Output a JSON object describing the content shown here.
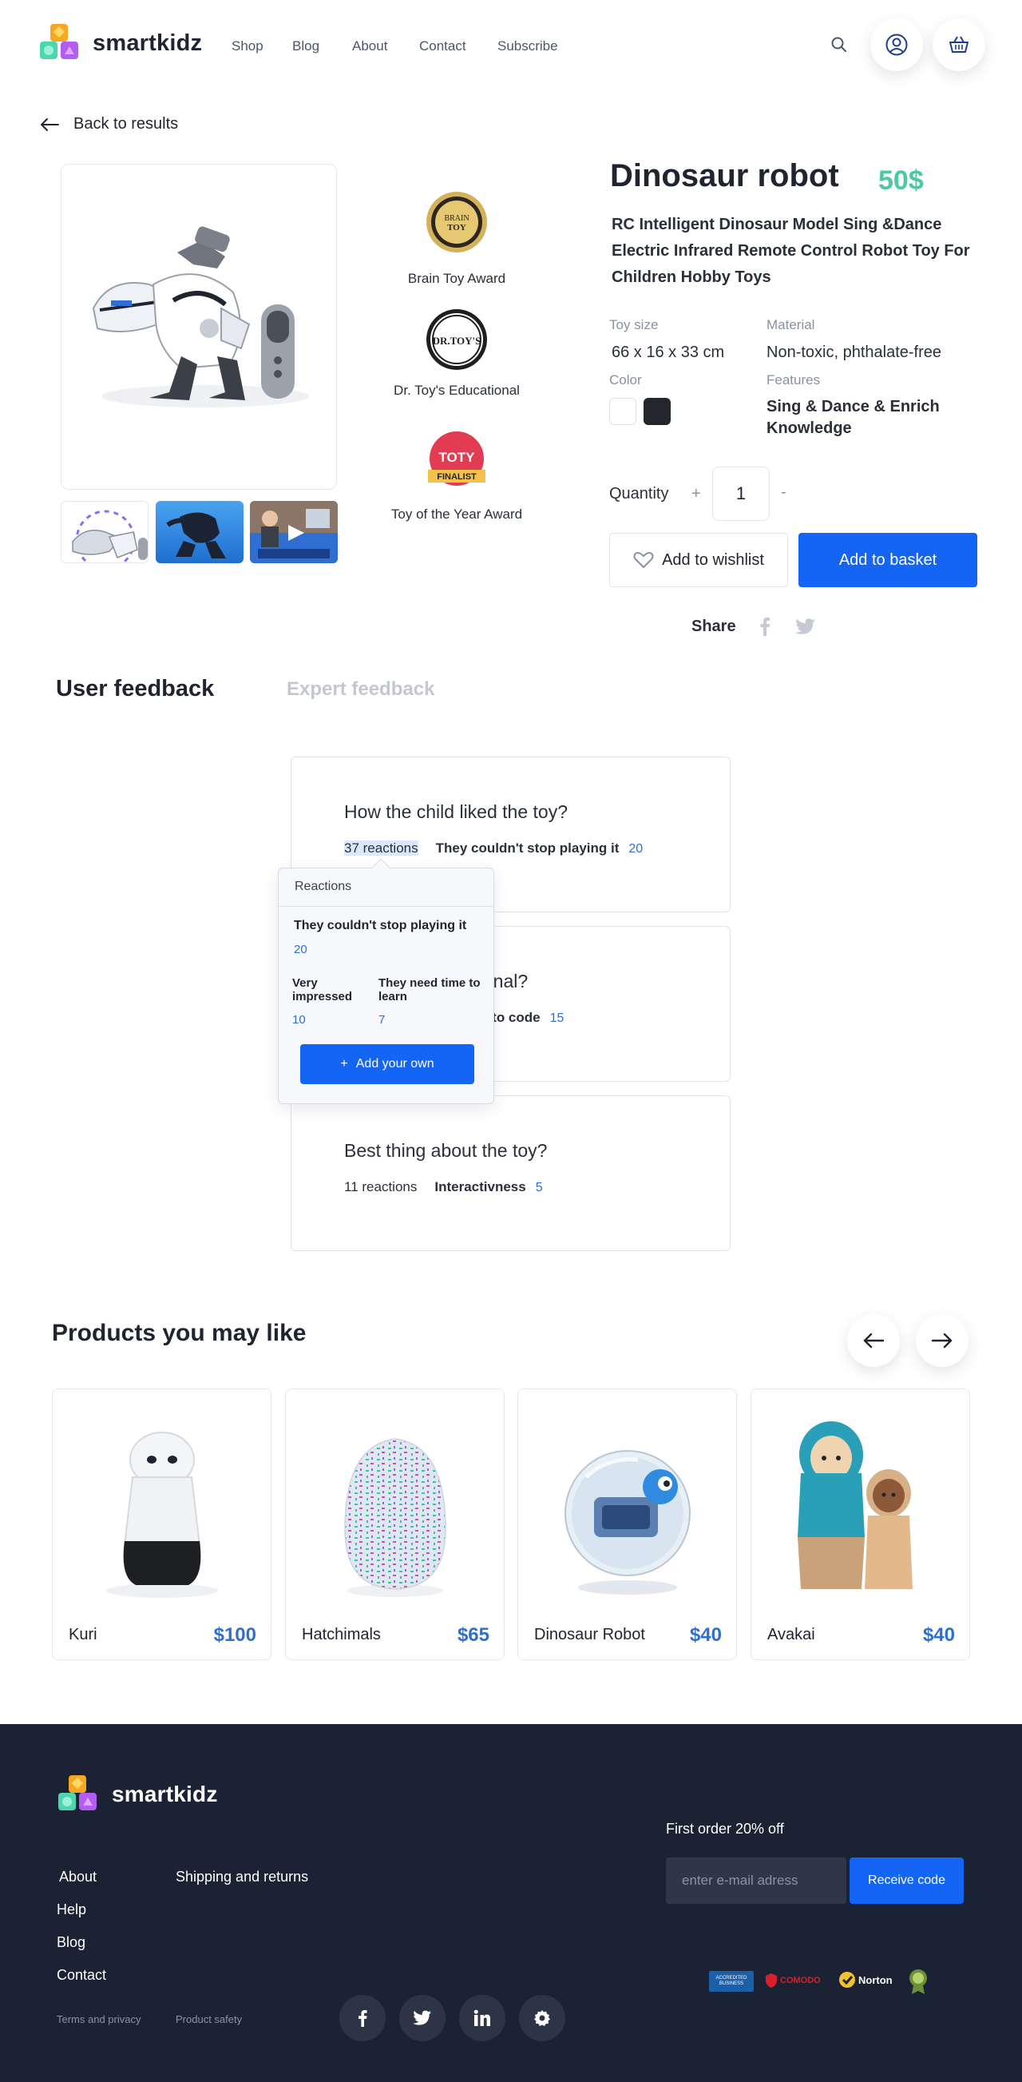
{
  "brand": {
    "name": "smartkidz",
    "colors": {
      "orange": "#f5a623",
      "teal": "#4cd6b0",
      "purple": "#b35cf0",
      "blue": "#1565f5",
      "green_price": "#4cc9a0"
    }
  },
  "nav": {
    "items": [
      "Shop",
      "Blog",
      "About",
      "Contact",
      "Subscribe"
    ],
    "icons": [
      "search-icon",
      "user-icon",
      "basket-icon"
    ]
  },
  "back_link": "Back to results",
  "product": {
    "title": "Dinosaur robot",
    "price": "50$",
    "subtitle": "RC Intelligent Dinosaur Model Sing &Dance Electric Infrared Remote Control Robot Toy For Children Hobby Toys",
    "awards": [
      {
        "label": "Brain Toy Award",
        "badge": "BRAIN TOY"
      },
      {
        "label": "Dr. Toy's Educational",
        "badge": "DR.TOY'S"
      },
      {
        "label": "Toy of the Year Award",
        "badge": "TOTY",
        "sub": "FINALIST"
      }
    ],
    "specs": {
      "toy_size_label": "Toy size",
      "toy_size": "66 x 16 x 33 cm",
      "material_label": "Material",
      "material": "Non-toxic, phthalate-free",
      "color_label": "Color",
      "colors": [
        "#ffffff",
        "#23262d"
      ],
      "features_label": "Features",
      "features": "Sing & Dance & Enrich Knowledge"
    },
    "quantity_label": "Quantity",
    "quantity": "1",
    "plus": "+",
    "minus": "-",
    "wishlist_label": "Add to wishlist",
    "basket_label": "Add to basket",
    "share_label": "Share"
  },
  "feedback": {
    "tabs": [
      "User feedback",
      "Expert feedback"
    ],
    "questions": [
      {
        "title": "How the child liked the toy?",
        "reactions": "37 reactions",
        "top": "They couldn't stop playing it",
        "count": "20"
      },
      {
        "title": "Is the toy educational?",
        "reactions": "",
        "top": "It quickly teaches how to code",
        "count": "15"
      },
      {
        "title": "Best thing about the toy?",
        "reactions": "11 reactions",
        "top": "Interactivness",
        "count": "5"
      }
    ],
    "popup": {
      "title": "Reactions",
      "main": {
        "label": "They couldn't stop playing it",
        "count": "20"
      },
      "others": [
        {
          "label": "Very impressed",
          "count": "10"
        },
        {
          "label": "They need time to learn",
          "count": "7"
        }
      ],
      "add_label": "Add your own",
      "add_prefix": "+"
    }
  },
  "related": {
    "title": "Products you may like",
    "products": [
      {
        "name": "Kuri",
        "price": "$100"
      },
      {
        "name": "Hatchimals",
        "price": "$65"
      },
      {
        "name": "Dinosaur Robot",
        "price": "$40"
      },
      {
        "name": "Avakai",
        "price": "$40"
      }
    ]
  },
  "footer": {
    "brand": "smartkidz",
    "links_col1": [
      "About",
      "Help",
      "Blog",
      "Contact"
    ],
    "links_col2": [
      "Shipping and returns"
    ],
    "small_links": [
      "Terms and privacy",
      "Product safety"
    ],
    "social": [
      "facebook-icon",
      "twitter-icon",
      "linkedin-icon",
      "settings-icon"
    ],
    "promo": "First order 20% off",
    "email_placeholder": "enter e-mail adress",
    "code_button": "Receive code",
    "badges": [
      "ACCREDITED BUSINESS",
      "COMODO",
      "Norton",
      "seal"
    ]
  }
}
